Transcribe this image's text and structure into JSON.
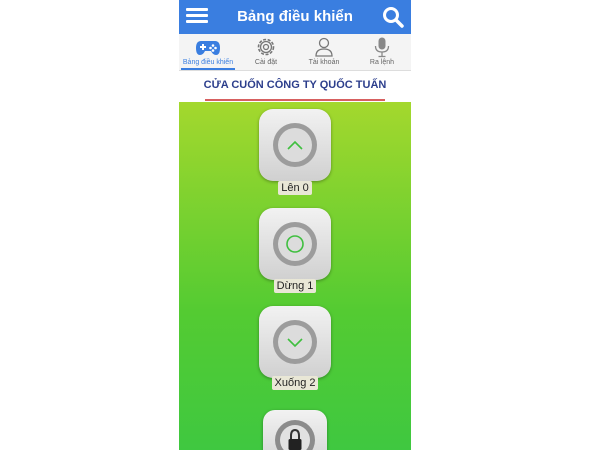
{
  "header": {
    "title": "Bảng điều khiển",
    "menu_icon": "hamburger-menu-icon",
    "search_icon": "search-icon",
    "bar_color": "#3a7ee0"
  },
  "tabs": [
    {
      "label": "Bảng điều khiển",
      "icon": "gamepad-icon",
      "active": true
    },
    {
      "label": "Cài đặt",
      "icon": "gear-icon",
      "active": false
    },
    {
      "label": "Tài khoản",
      "icon": "person-icon",
      "active": false
    },
    {
      "label": "Ra lệnh",
      "icon": "microphone-icon",
      "active": false
    }
  ],
  "company": {
    "name": "CỬA CUỐN CÔNG TY QUỐC TUẤN"
  },
  "controls": [
    {
      "label": "Lên 0",
      "icon": "arrow-up-icon"
    },
    {
      "label": "Dừng 1",
      "icon": "stop-circle-icon"
    },
    {
      "label": "Xuống 2",
      "icon": "arrow-down-icon"
    },
    {
      "label": "",
      "icon": "lock-icon"
    }
  ],
  "colors": {
    "accent": "#3a7ee0",
    "company_text": "#2c3e8c",
    "control_gradient_top": "#a4d82d",
    "control_gradient_bottom": "#3fc840",
    "icon_green": "#3fbf3f"
  }
}
